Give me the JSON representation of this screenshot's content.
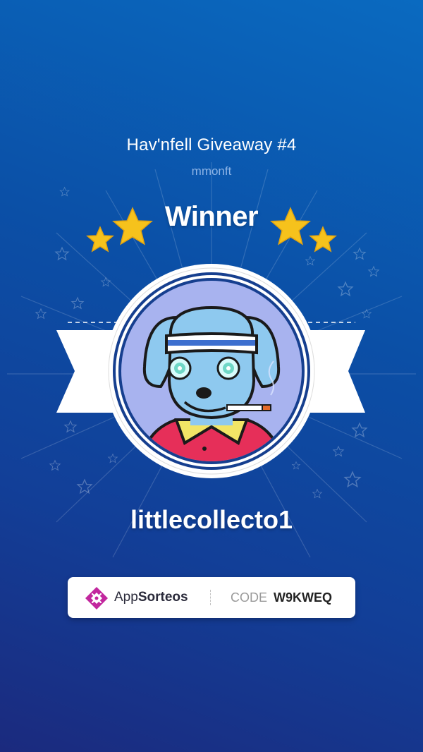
{
  "giveaway": {
    "title": "Hav'nfell Giveaway #4",
    "host": "mmonft",
    "heading": "Winner"
  },
  "winner": {
    "username": "littlecollecto1",
    "avatar_icon": "blue-dog-with-headband-avatar"
  },
  "footer": {
    "brand_prefix": "App",
    "brand_suffix": "Sorteos",
    "code_label": "CODE",
    "code_value": "W9KWEQ",
    "logo_icon": "appsorteos-logo-icon"
  },
  "colors": {
    "background_top": "#0a6ac0",
    "background_bottom": "#1b2a7e",
    "star": "#f6c21c",
    "ribbon": "#ffffff",
    "badge_ring": "#163f8f",
    "avatar_bg": "#a8b3ef",
    "logo": "#c2279e"
  }
}
